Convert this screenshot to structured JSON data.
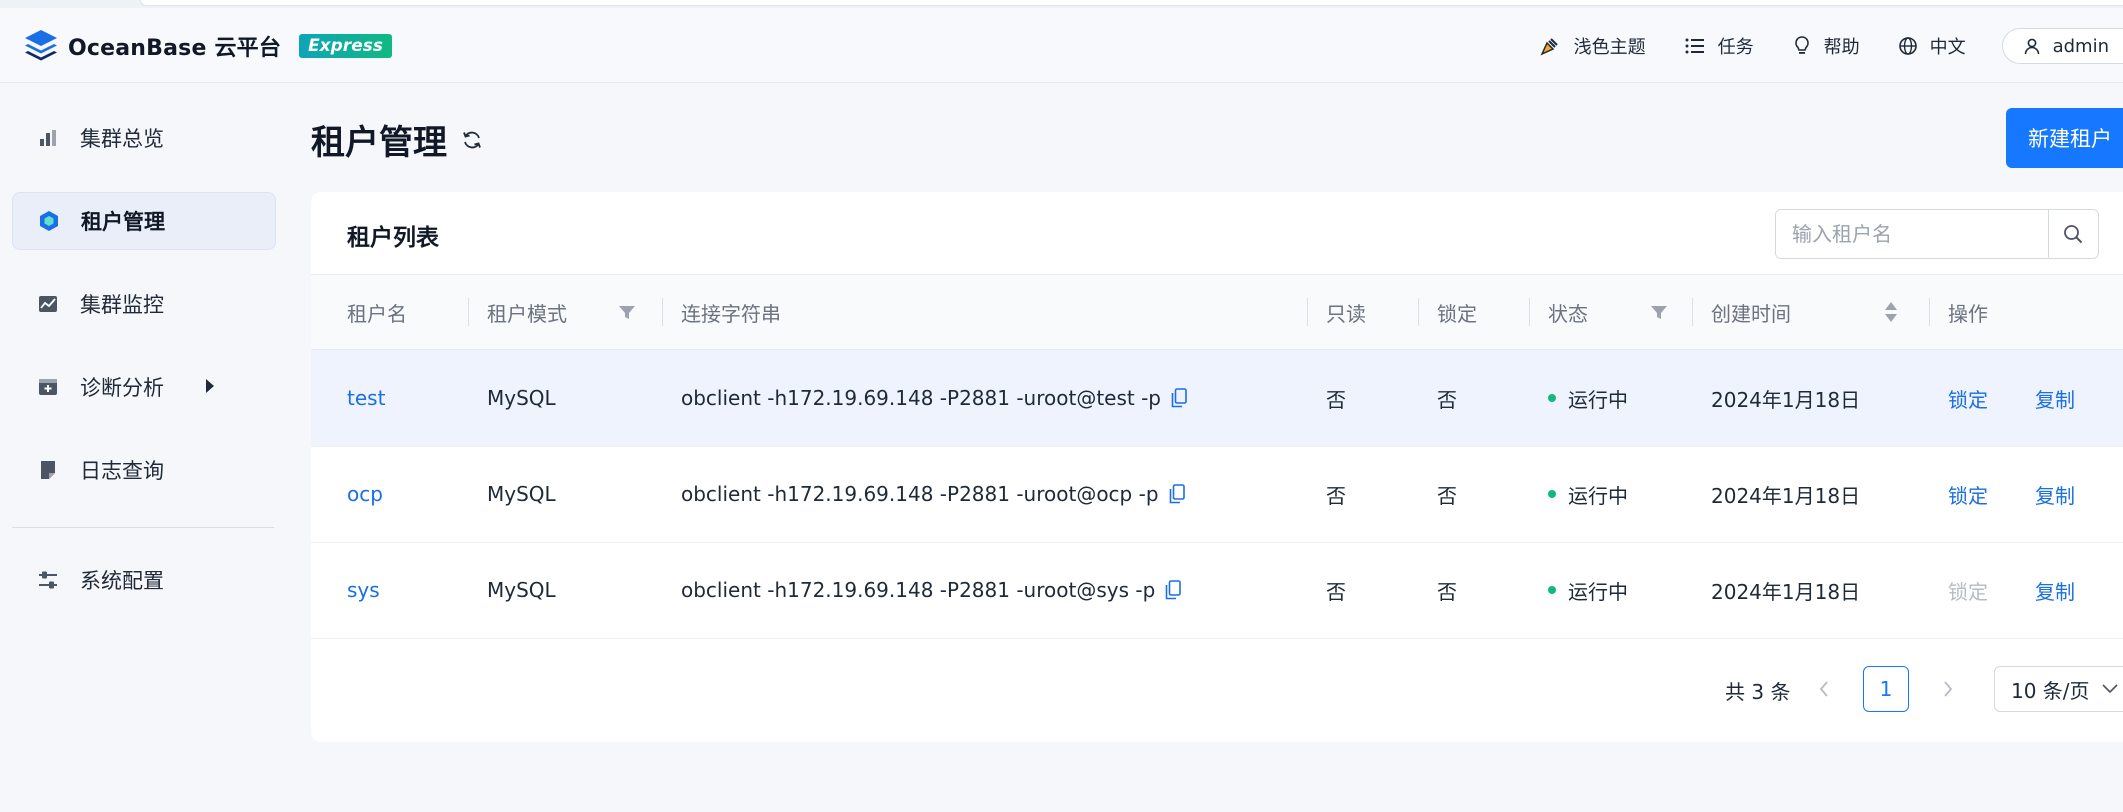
{
  "app": {
    "brand": "OceanBase 云平台",
    "edition": "Express"
  },
  "topnav": {
    "theme": "浅色主题",
    "tasks": "任务",
    "help": "帮助",
    "language": "中文",
    "user": "admin"
  },
  "sidebar": {
    "items": [
      {
        "label": "集群总览",
        "icon": "bar-chart-icon"
      },
      {
        "label": "租户管理",
        "icon": "tenant-hexagon-icon"
      },
      {
        "label": "集群监控",
        "icon": "monitor-chart-icon"
      },
      {
        "label": "诊断分析",
        "icon": "diagnosis-icon"
      },
      {
        "label": "日志查询",
        "icon": "log-document-icon"
      },
      {
        "label": "系统配置",
        "icon": "settings-sliders-icon"
      }
    ]
  },
  "page": {
    "title": "租户管理",
    "new_button": "新建租户"
  },
  "tenant_list": {
    "title": "租户列表",
    "search_placeholder": "输入租户名",
    "columns": [
      "租户名",
      "租户模式",
      "连接字符串",
      "只读",
      "锁定",
      "状态",
      "创建时间",
      "操作"
    ],
    "rows": [
      {
        "name": "test",
        "mode": "MySQL",
        "conn": "obclient -h172.19.69.148 -P2881 -uroot@test -p",
        "readonly": "否",
        "locked": "否",
        "status": "运行中",
        "created": "2024年1月18日",
        "lock_action": "锁定",
        "copy_action": "复制"
      },
      {
        "name": "ocp",
        "mode": "MySQL",
        "conn": "obclient -h172.19.69.148 -P2881 -uroot@ocp -p",
        "readonly": "否",
        "locked": "否",
        "status": "运行中",
        "created": "2024年1月18日",
        "lock_action": "锁定",
        "copy_action": "复制"
      },
      {
        "name": "sys",
        "mode": "MySQL",
        "conn": "obclient -h172.19.69.148 -P2881 -uroot@sys -p",
        "readonly": "否",
        "locked": "否",
        "status": "运行中",
        "created": "2024年1月18日",
        "lock_action": "锁定",
        "copy_action": "复制"
      }
    ]
  },
  "pagination": {
    "total": "共 3 条",
    "current_page": "1",
    "page_size": "10 条/页"
  },
  "colors": {
    "primary": "#1677ff",
    "link": "#1a6ee6",
    "status_running": "#10b981",
    "active_nav_bg": "#e9eef9"
  }
}
